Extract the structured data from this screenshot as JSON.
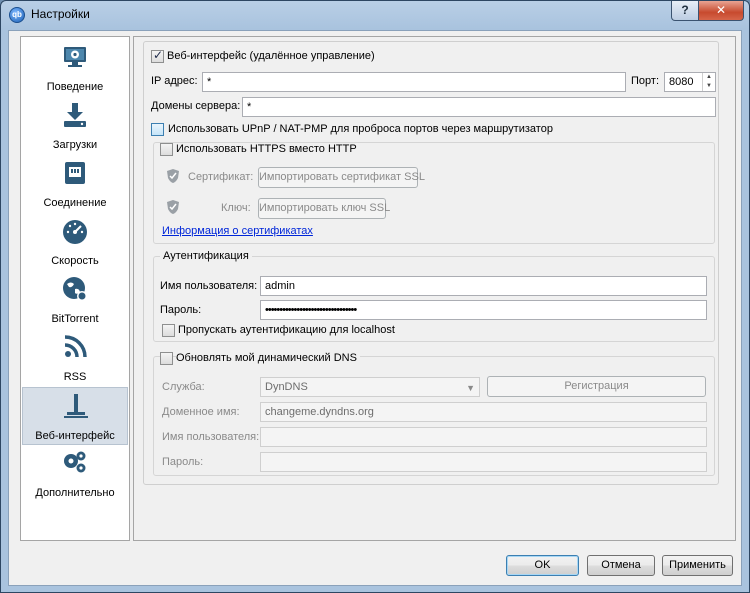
{
  "window": {
    "title": "Настройки",
    "help": "?",
    "close": "✕",
    "app_icon_text": "qb"
  },
  "sidebar": {
    "items": [
      {
        "label": "Поведение",
        "icon": "monitor-gear-icon"
      },
      {
        "label": "Загрузки",
        "icon": "download-icon"
      },
      {
        "label": "Соединение",
        "icon": "network-port-icon"
      },
      {
        "label": "Скорость",
        "icon": "speedometer-icon"
      },
      {
        "label": "BitTorrent",
        "icon": "globe-icon"
      },
      {
        "label": "RSS",
        "icon": "rss-icon"
      },
      {
        "label": "Веб-интерфейс",
        "icon": "web-ui-icon",
        "selected": true
      },
      {
        "label": "Дополнительно",
        "icon": "gears-icon"
      }
    ]
  },
  "webui": {
    "enable_label": "Веб-интерфейс (удалённое управление)",
    "ip_label": "IP адрес:",
    "ip_value": "*",
    "port_label": "Порт:",
    "port_value": "8080",
    "domains_label": "Домены сервера:",
    "domains_value": "*",
    "upnp_label": "Использовать UPnP / NAT-PMP для проброса портов через маршрутизатор",
    "https": {
      "label": "Использовать HTTPS вместо HTTP",
      "cert_label": "Сертификат:",
      "cert_button": "Импортировать сертификат SSL",
      "key_label": "Ключ:",
      "key_button": "Импортировать ключ SSL",
      "info_link": "Информация о сертификатах"
    },
    "auth": {
      "title": "Аутентификация",
      "user_label": "Имя пользователя:",
      "user_value": "admin",
      "pass_label": "Пароль:",
      "pass_value": "••••••••••••••••••••••••••••••••",
      "bypass_label": "Пропускать аутентификацию для localhost"
    },
    "dyndns": {
      "label": "Обновлять мой динамический DNS",
      "service_label": "Служба:",
      "service_value": "DynDNS",
      "register_button": "Регистрация",
      "domain_label": "Доменное имя:",
      "domain_value": "changeme.dyndns.org",
      "user_label": "Имя пользователя:",
      "pass_label": "Пароль:"
    }
  },
  "footer": {
    "ok": "OK",
    "cancel": "Отмена",
    "apply": "Применить"
  }
}
